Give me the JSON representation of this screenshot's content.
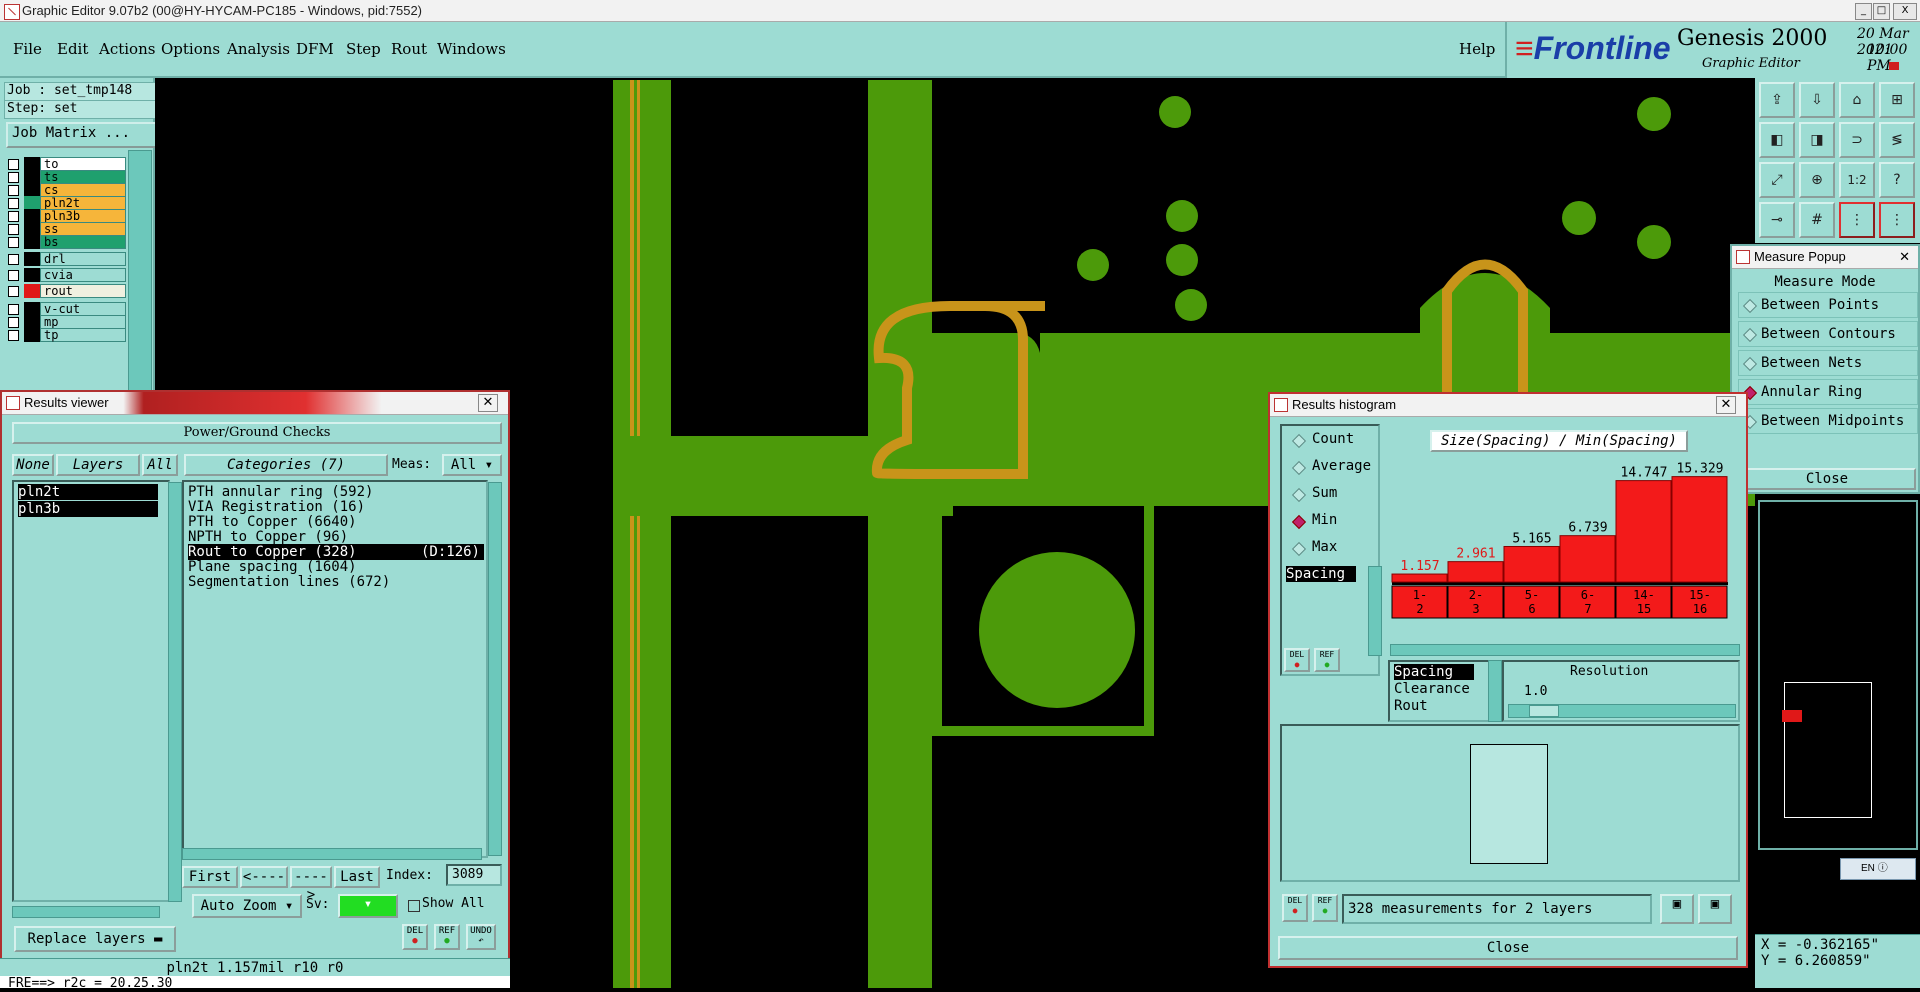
{
  "window": {
    "title": "Graphic Editor 9.07b2 (00@HY-HYCAM-PC185 - Windows, pid:7552)",
    "minimize": "_",
    "maximize": "□",
    "close": "X"
  },
  "menu": {
    "items": [
      "File",
      "Edit",
      "Actions",
      "Options",
      "Analysis",
      "DFM",
      "Step",
      "Rout",
      "Windows"
    ],
    "help": "Help"
  },
  "brand": {
    "logo": "Frontline",
    "product": "Genesis 2000",
    "subtitle": "Graphic Editor",
    "date": "20 Mar 2021",
    "time": "10:00 PM"
  },
  "job": {
    "job_line": "Job : set_tmp148",
    "step_line": "Step: set",
    "matrix_button": "Job Matrix ..."
  },
  "layers": [
    {
      "name": "to",
      "color": "#ffffff",
      "swatch": "#000000"
    },
    {
      "name": "ts",
      "color": "#1fa06e",
      "swatch": "#000000"
    },
    {
      "name": "cs",
      "color": "#f6b53a",
      "swatch": "#000000"
    },
    {
      "name": "pln2t",
      "color": "#f6b53a",
      "swatch": "#1fa06e"
    },
    {
      "name": "pln3b",
      "color": "#f6b53a",
      "swatch": "#000000"
    },
    {
      "name": "ss",
      "color": "#f6b53a",
      "swatch": "#000000"
    },
    {
      "name": "bs",
      "color": "#1fa06e",
      "swatch": "#000000"
    },
    {
      "name": "drl",
      "color": "#9ddcd3",
      "swatch": "#000000"
    },
    {
      "name": "cvia",
      "color": "#9ddcd3",
      "swatch": "#000000"
    },
    {
      "name": "rout",
      "color": "#f0f0e0",
      "swatch": "#e01818"
    },
    {
      "name": "v-cut",
      "color": "#9ddcd3",
      "swatch": "#000000"
    },
    {
      "name": "mp",
      "color": "#9ddcd3",
      "swatch": "#000000"
    },
    {
      "name": "tp",
      "color": "#9ddcd3",
      "swatch": "#000000"
    }
  ],
  "measure": {
    "title": "Measure Popup",
    "header": "Measure Mode",
    "options": [
      {
        "label": "Between Points",
        "selected": false
      },
      {
        "label": "Between Contours",
        "selected": false
      },
      {
        "label": "Between Nets",
        "selected": false
      },
      {
        "label": "Annular Ring",
        "selected": true
      },
      {
        "label": "Between Midpoints",
        "selected": false
      }
    ],
    "close": "Close"
  },
  "results_viewer": {
    "title": "Results viewer",
    "check_name": "Power/Ground Checks",
    "none_btn": "None",
    "layers_btn": "Layers",
    "all_btn": "All",
    "categories_btn": "Categories (7)",
    "meas_label": "Meas:",
    "meas_value": "All",
    "layer_list": [
      "pln2t",
      "pln3b"
    ],
    "categories": [
      {
        "text": "PTH annular ring (592)",
        "extra": "",
        "selected": false
      },
      {
        "text": "VIA Registration (16)",
        "extra": "",
        "selected": false
      },
      {
        "text": "PTH to Copper (6640)",
        "extra": "",
        "selected": false
      },
      {
        "text": "NPTH to Copper (96)",
        "extra": "",
        "selected": false
      },
      {
        "text": "Rout to Copper (328)",
        "extra": "(D:126)",
        "selected": true
      },
      {
        "text": "Plane spacing (1604)",
        "extra": "",
        "selected": false
      },
      {
        "text": "Segmentation lines (672)",
        "extra": "",
        "selected": false
      }
    ],
    "first_btn": "First",
    "prev_btn": "<----",
    "next_btn": "---->",
    "last_btn": "Last",
    "index_label": "Index:",
    "index_value": "3089",
    "replace_btn": "Replace layers",
    "auto_zoom": "Auto Zoom",
    "sv_label": "Sv:",
    "show_all": "Show All",
    "del": "DEL",
    "ref": "REF",
    "undo": "UNDO"
  },
  "status": {
    "line1": "pln2t 1.157mil  r10  r0",
    "line2": "FRE==> r2c = 20.25.30"
  },
  "histogram": {
    "title": "Results histogram",
    "modes": [
      {
        "label": "Count",
        "selected": false
      },
      {
        "label": "Average",
        "selected": false
      },
      {
        "label": "Sum",
        "selected": false
      },
      {
        "label": "Min",
        "selected": true
      },
      {
        "label": "Max",
        "selected": false
      }
    ],
    "heading": "Size(Spacing) / Min(Spacing)",
    "side_list": [
      "Spacing"
    ],
    "type_list": [
      "Spacing",
      "Clearance",
      "Rout"
    ],
    "resolution_label": "Resolution",
    "resolution_value": "1.0",
    "summary": "328 measurements for 2 layers",
    "close": "Close",
    "del": "DEL",
    "ref": "REF"
  },
  "chart_data": {
    "type": "bar",
    "categories": [
      "1-\n2",
      "2-\n3",
      "5-\n6",
      "6-\n7",
      "14-\n15",
      "15-\n16"
    ],
    "values": [
      1.157,
      2.961,
      5.165,
      6.739,
      14.747,
      15.329
    ],
    "ylim": [
      0,
      16
    ],
    "value_colors": [
      "#e01818",
      "#e01818",
      "#000000",
      "#000000",
      "#000000",
      "#000000"
    ]
  },
  "coords": {
    "x": "X = -0.362165\"",
    "y": "Y =  6.260859\""
  },
  "tray": {
    "lang": "EN"
  }
}
